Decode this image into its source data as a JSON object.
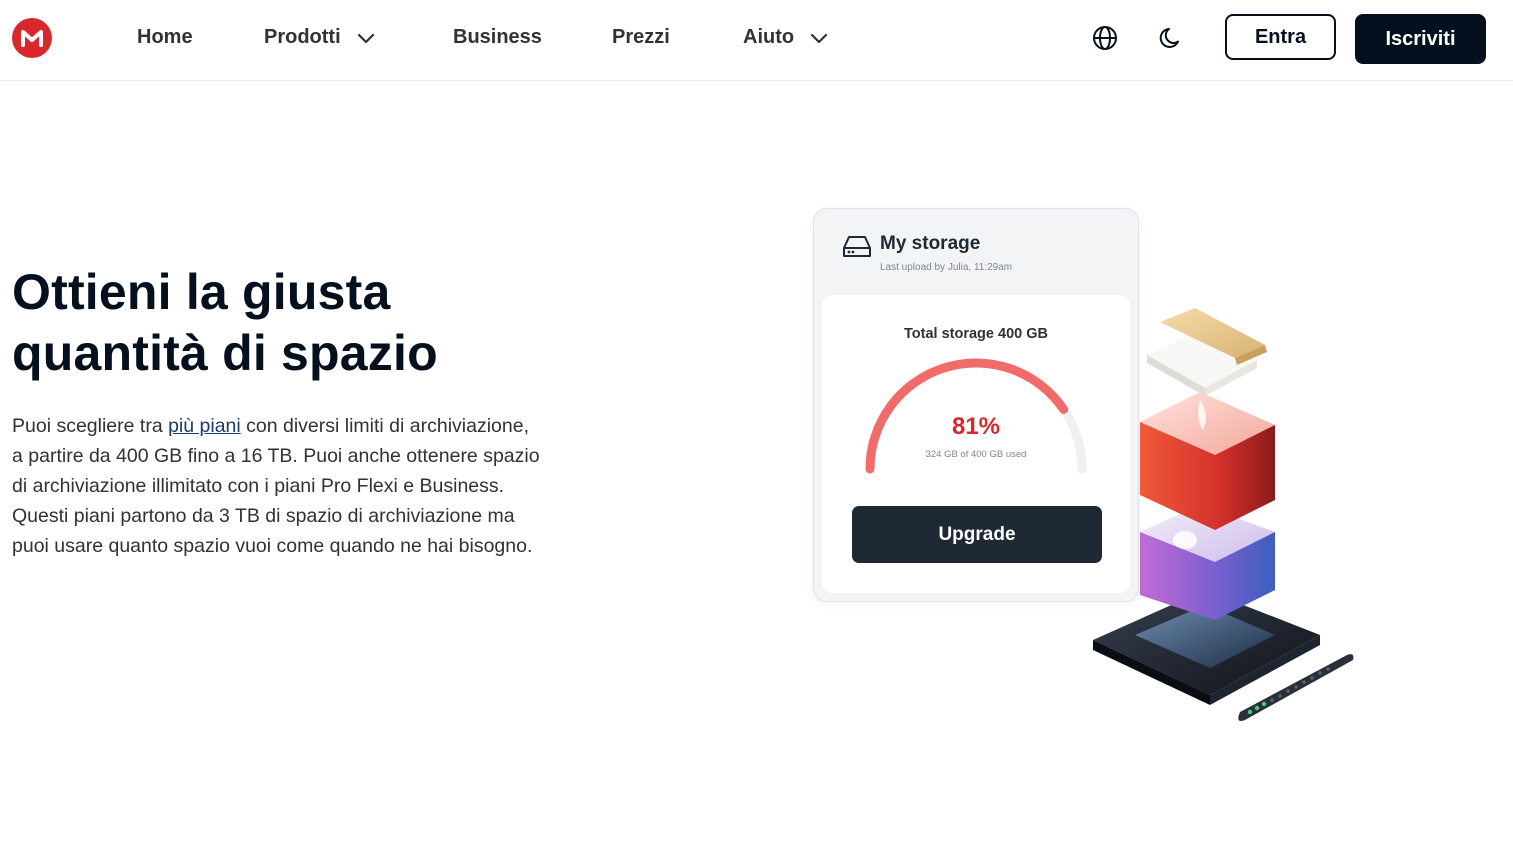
{
  "header": {
    "logo_letter": "M",
    "nav": {
      "home": "Home",
      "prodotti": "Prodotti",
      "business": "Business",
      "prezzi": "Prezzi",
      "aiuto": "Aiuto"
    },
    "icons": {
      "language": "globe-icon",
      "theme": "moon-icon",
      "dropdown": "chevron-down-icon"
    },
    "login_label": "Entra",
    "signup_label": "Iscriviti"
  },
  "hero": {
    "title_line1": "Ottieni la giusta",
    "title_line2": "quantità di spazio",
    "body_before_link": "Puoi scegliere tra ",
    "body_link": "più piani",
    "body_after_link": " con diversi limiti di archiviazione, a partire da 400 GB fino a 16 TB. Puoi anche ottenere spazio di archiviazione illimitato con i piani Pro Flexi e Business. Questi piani partono da 3 TB di spazio di archiviazione ma puoi usare quanto spazio vuoi come quando ne hai bisogno."
  },
  "storage_card": {
    "icon": "hard-drive-icon",
    "title": "My storage",
    "subtitle": "Last upload by Julia, 11:29am",
    "total_label": "Total storage 400 GB",
    "percent_label": "81%",
    "used_fraction": 0.81,
    "used_label": "324 GB of 400 GB used",
    "upgrade_label": "Upgrade"
  },
  "colors": {
    "brand_red": "#d9272e",
    "gauge_fill": "#f26b6b",
    "gauge_track": "#eef0f2",
    "dark": "#04101e",
    "button_dark": "#1f2933",
    "link": "#1b3a70"
  }
}
